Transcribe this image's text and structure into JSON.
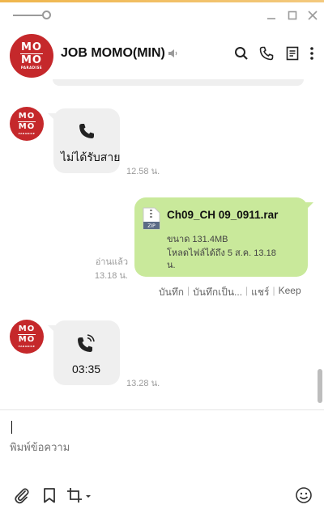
{
  "window": {
    "controls": [
      "minimize-icon",
      "maximize-icon",
      "close-icon"
    ]
  },
  "header": {
    "avatar": {
      "line1": "MO",
      "line2": "MO",
      "sub": "PARADISE"
    },
    "title": "JOB MOMO(MIN)",
    "icons": [
      "mute-icon",
      "search-icon",
      "phone-icon",
      "notes-icon",
      "more-icon"
    ]
  },
  "messages": [
    {
      "type": "missed-call",
      "direction": "incoming",
      "text": "ไม่ได้รับสาย",
      "time": "12.58 น."
    },
    {
      "type": "file",
      "direction": "outgoing",
      "file_name": "Ch09_CH 09_0911.rar",
      "size_label": "ขนาด 131.4MB",
      "download_label_1": "โหลดไฟล์ได้ถึง 5 ส.ค. 13.18",
      "download_label_2": "น.",
      "read_label": "อ่านแล้ว",
      "time": "13.18 น.",
      "actions": [
        "บันทึก",
        "บันทึกเป็น...",
        "แชร์",
        "Keep"
      ]
    },
    {
      "type": "call",
      "direction": "incoming",
      "duration": "03:35",
      "time": "13.28 น."
    }
  ],
  "composer": {
    "placeholder": "พิมพ์ข้อความ",
    "icons": [
      "attachment-icon",
      "bookmark-icon",
      "crop-icon",
      "emoji-icon"
    ]
  },
  "colors": {
    "brand": "#c5282b",
    "outgoing_bubble": "#c9e99b",
    "incoming_bubble": "#efefef",
    "accent_bar": "#f0b64c"
  }
}
